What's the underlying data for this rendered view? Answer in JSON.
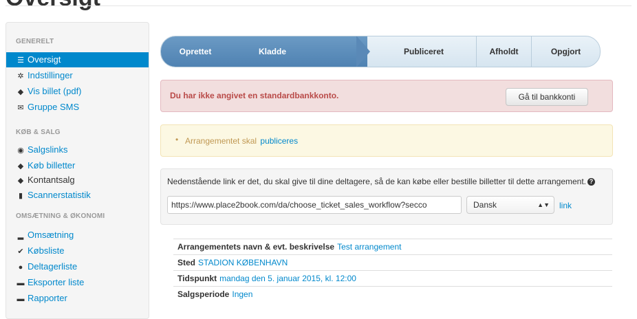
{
  "page": {
    "title": "Oversigt"
  },
  "sidebar": {
    "sections": [
      {
        "heading": "GENERELT",
        "items": [
          {
            "label": "Oversigt",
            "icon": "list-icon",
            "active": true
          },
          {
            "label": "Indstillinger",
            "icon": "gear-icon"
          },
          {
            "label": "Vis billet (pdf)",
            "icon": "tag-icon"
          },
          {
            "label": "Gruppe SMS",
            "icon": "envelope-icon"
          }
        ]
      },
      {
        "heading": "KØB & SALG",
        "items": [
          {
            "label": "Salgslinks",
            "icon": "globe-icon"
          },
          {
            "label": "Køb billetter",
            "icon": "tag-icon"
          },
          {
            "label": "Kontantsalg",
            "icon": "tags-icon"
          },
          {
            "label": "Scannerstatistik",
            "icon": "barcode-icon"
          }
        ]
      },
      {
        "heading": "OMSÆTNING & ØKONOMI",
        "items": [
          {
            "label": "Omsætning",
            "icon": "bar-chart-icon"
          },
          {
            "label": "Købsliste",
            "icon": "check-icon"
          },
          {
            "label": "Deltagerliste",
            "icon": "user-icon"
          },
          {
            "label": "Eksporter liste",
            "icon": "folder-icon"
          },
          {
            "label": "Rapporter",
            "icon": "folder-icon"
          }
        ]
      }
    ]
  },
  "steps": {
    "items": [
      "Oprettet",
      "Kladde",
      "Publiceret",
      "Afholdt",
      "Opgjort"
    ],
    "completed_count": 2
  },
  "alert_error": {
    "message": "Du har ikke angivet en standardbankkonto.",
    "button": "Gå til bankkonti"
  },
  "alert_warning": {
    "text": "Arrangementet skal",
    "link": "publiceres"
  },
  "share": {
    "intro": "Nedenstående link er det, du skal give til dine deltagere, så de kan købe eller bestille billetter til dette arrangement.",
    "help_icon": "question-circle-icon",
    "url": "https://www.place2book.com/da/choose_ticket_sales_workflow?secco",
    "language": "Dansk",
    "link_label": "link"
  },
  "details": [
    {
      "label": "Arrangementets navn & evt. beskrivelse",
      "value": "Test arrangement"
    },
    {
      "label": "Sted",
      "value": "STADION KØBENHAVN"
    },
    {
      "label": "Tidspunkt",
      "value": "mandag den 5. januar 2015, kl. 12:00"
    },
    {
      "label": "Salgsperiode",
      "value": "Ingen"
    }
  ],
  "colors": {
    "accent": "#0088cc",
    "error_bg": "#f2dede",
    "error_text": "#b94a48",
    "warning_bg": "#fcf8e3",
    "warning_text": "#c09853",
    "step_done": "#5a89b7"
  }
}
